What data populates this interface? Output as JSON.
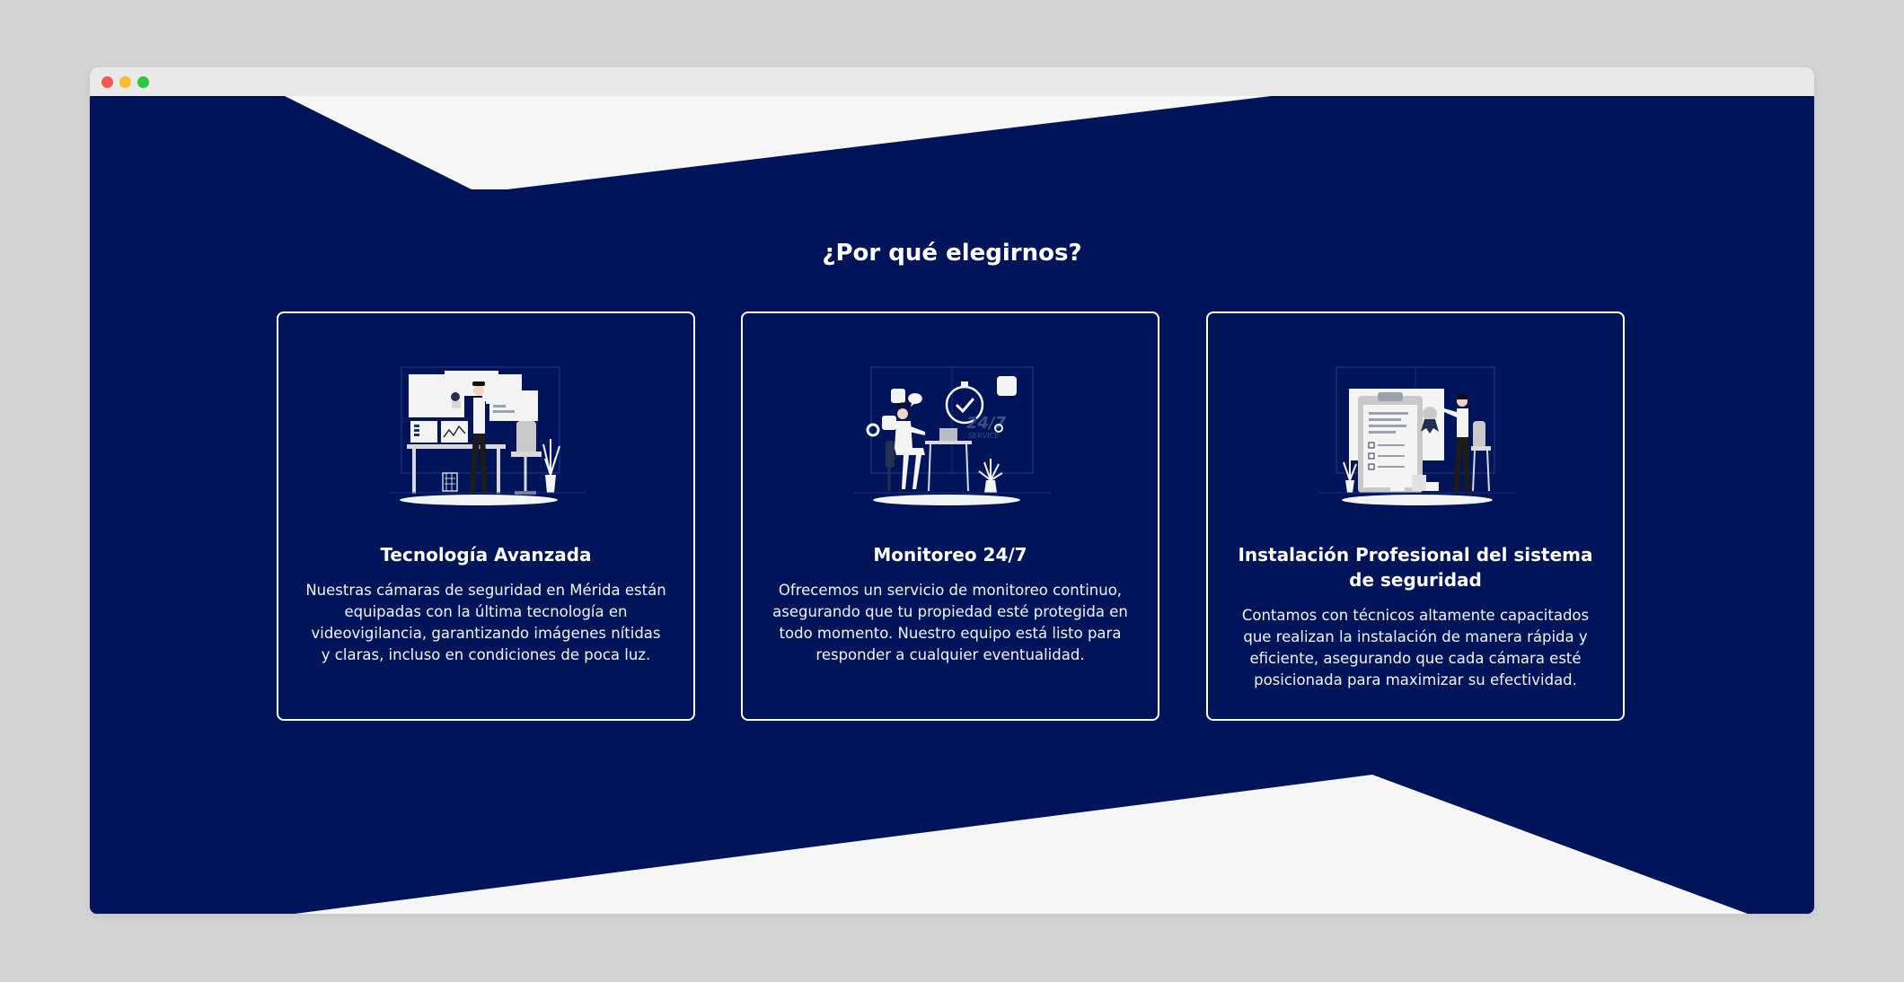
{
  "browser": {
    "controls": [
      "close",
      "minimize",
      "maximize"
    ]
  },
  "section": {
    "heading": "¿Por qué elegirnos?",
    "background_color": "#001459",
    "shape_color": "#f6f6f6"
  },
  "cards": [
    {
      "title": "Tecnología Avanzada",
      "text": "Nuestras cámaras de seguridad en Mérida están equipadas con la última tecnología en videovigilancia, garantizando imágenes nítidas y claras, incluso en condiciones de poca luz.",
      "illustration": "surveillance-operator-illustration"
    },
    {
      "title": "Monitoreo 24/7",
      "badge": "24/7",
      "badge_sub": "SERVICE",
      "text": "Ofrecemos un servicio de monitoreo continuo, asegurando que tu propiedad esté protegida en todo momento. Nuestro equipo está listo para responder a cualquier eventualidad.",
      "illustration": "support-247-illustration"
    },
    {
      "title": "Instalación Profesional del sistema de seguridad",
      "text": "Contamos con técnicos altamente capacitados que realizan la instalación de manera rápida y eficiente, asegurando que cada cámara esté posicionada para maximizar su efectividad.",
      "illustration": "checklist-installer-illustration"
    }
  ]
}
